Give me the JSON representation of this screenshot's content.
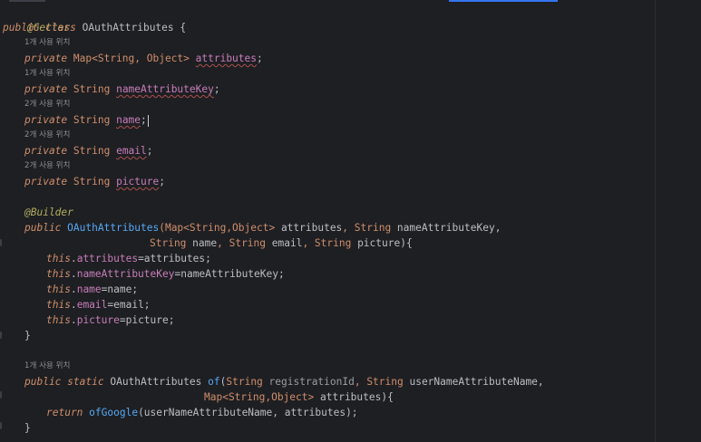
{
  "editor": {
    "hints": {
      "h1": "1개 사용 위치",
      "h2": "1개 사용 위치",
      "h3": "2개 사용 위치",
      "h4": "2개 사용 위치",
      "h5": "2개 사용 위치",
      "h6": "1개 사용 위치"
    },
    "code": {
      "getter": "@Getter",
      "public": "public",
      "class": "class",
      "private": "private",
      "static": "static",
      "this": "this",
      "return": "return",
      "builder": "@Builder",
      "class_name": "OAuthAttributes",
      "open_brace": " {",
      "close_brace": "}",
      "map_type": "Map<String, Object>",
      "map_type2": "Map<String,Object>",
      "string": "String",
      "f_attributes": "attributes",
      "f_nameAttributeKey": "nameAttributeKey",
      "f_name": "name",
      "f_email": "email",
      "f_picture": "picture",
      "semi": ";",
      "ctor_sig_1": "(Map<String,Object> ",
      "p_attributes": "attributes",
      "comma_string": ", String ",
      "p_nameAttributeKey": "nameAttributeKey",
      "comma": ",",
      "p_name": "name",
      "p_email": "email",
      "p_picture": "picture",
      "close_paren_brace": "){",
      "dot": ".",
      "assign_attributes": "=attributes;",
      "assign_nameAttributeKey": "=nameAttributeKey;",
      "assign_name": "=name;",
      "assign_email": "=email;",
      "assign_picture": "=picture;",
      "method_of": "of",
      "open_paren": "(",
      "p_registrationId": "registrationId",
      "p_userNameAttributeName": "userNameAttributeName",
      "method_ofGoogle": "ofGoogle",
      "call_args": "(userNameAttributeName, attributes);"
    }
  }
}
